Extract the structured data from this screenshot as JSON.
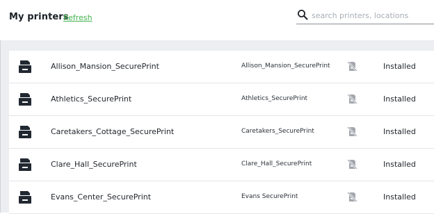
{
  "header": {
    "title": "My printers",
    "refresh_label": "Refresh"
  },
  "search": {
    "placeholder": "search printers, locations",
    "value": "",
    "icon": "search-icon"
  },
  "printers": [
    {
      "name": "Allison_Mansion_SecurePrint",
      "location": "Allison_Mansion_SecurePrint",
      "status": "Installed",
      "icon": "printer-icon",
      "status_icon": "printer-disabled-icon"
    },
    {
      "name": "Athletics_SecurePrint",
      "location": "Athletics_SecurePrint",
      "status": "Installed",
      "icon": "printer-icon",
      "status_icon": "printer-disabled-icon"
    },
    {
      "name": "Caretakers_Cottage_SecurePrint",
      "location": "Caretakers_SecurePrint",
      "status": "Installed",
      "icon": "printer-icon",
      "status_icon": "printer-disabled-icon"
    },
    {
      "name": "Clare_Hall_SecurePrint",
      "location": "Clare_Hall_SecurePrint",
      "status": "Installed",
      "icon": "printer-icon",
      "status_icon": "printer-disabled-icon"
    },
    {
      "name": "Evans_Center_SecurePrint",
      "location": "Evans SecurePrint",
      "status": "Installed",
      "icon": "printer-icon",
      "status_icon": "printer-disabled-icon"
    }
  ],
  "colors": {
    "accent": "#3fb24c",
    "background": "#eceef1",
    "icon": "#222831",
    "status_icon": "#a3a7ad"
  }
}
